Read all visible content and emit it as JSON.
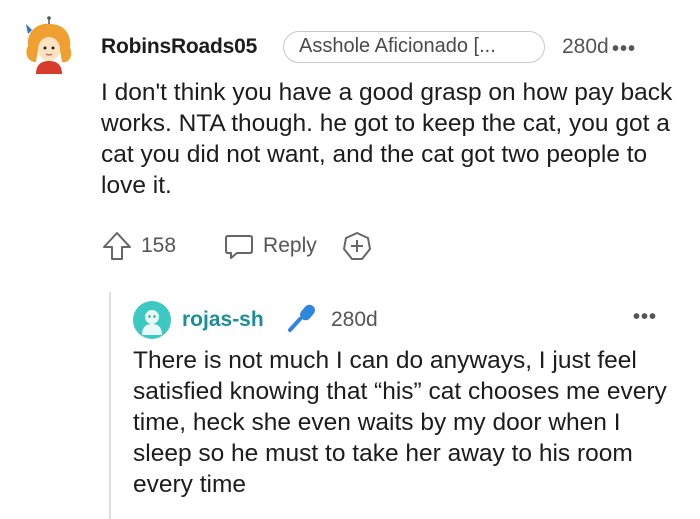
{
  "comment": {
    "username": "RobinsRoads05",
    "flair": "Asshole Aficionado [...",
    "time": "280d",
    "more": "•••",
    "body": "I don't think you have a good grasp on how pay back works. NTA though. he got to keep the cat, you got a cat you did not want, and the cat got two people to love it.",
    "votes": "158",
    "reply_label": "Reply",
    "icons": {
      "upvote": "upvote-arrow-icon",
      "reply": "speech-bubble-icon",
      "award": "add-award-icon"
    }
  },
  "reply": {
    "username": "rojas-sh",
    "time": "280d",
    "more": "•••",
    "body": "There is not much I can do anyways, I just feel satisfied knowing that “his” cat chooses me every time, heck she even waits by my door when I sleep so he must to take her away to his room every time",
    "username_color": "#1a8f9a",
    "icons": {
      "badge": "microphone-icon"
    }
  }
}
